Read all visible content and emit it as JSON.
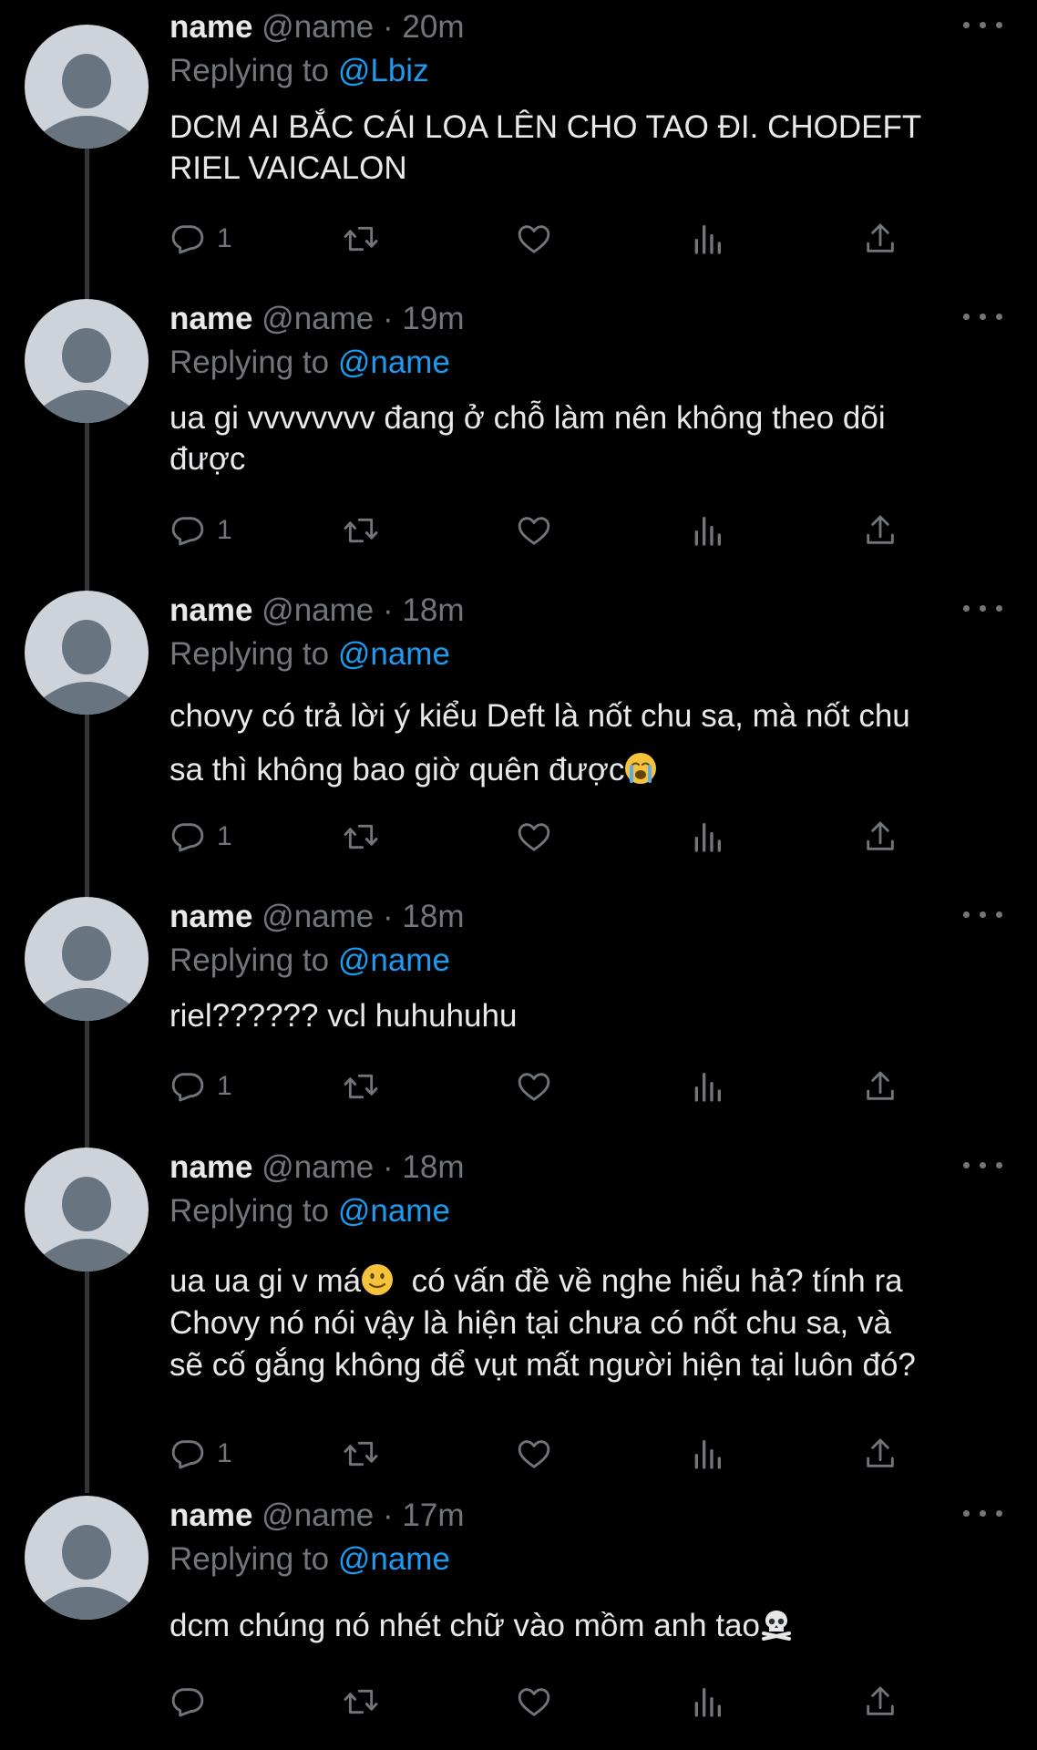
{
  "tweets": [
    {
      "display_name": "name",
      "handle": "@name",
      "separator": "·",
      "time": "20m",
      "replying_label": "Replying to",
      "replying_to": "@Lbiz",
      "text": "DCM AI BẮC CÁI LOA LÊN CHO TAO ĐI. CHODEFT\nRIEL VAICALON",
      "reply_count": "1"
    },
    {
      "display_name": "name",
      "handle": "@name",
      "separator": "·",
      "time": "19m",
      "replying_label": "Replying to",
      "replying_to": "@name",
      "text": "ua gi vvvvvvvv đang ở chỗ làm nên không theo dõi\nđược",
      "reply_count": "1"
    },
    {
      "display_name": "name",
      "handle": "@name",
      "separator": "·",
      "time": "18m",
      "replying_label": "Replying to",
      "replying_to": "@name",
      "text": "chovy có trả lời ý kiểu Deft là nốt chu sa, mà nốt chu\nsa thì không bao giờ quên được",
      "emoji": "loudly-crying-face-emoji",
      "reply_count": "1"
    },
    {
      "display_name": "name",
      "handle": "@name",
      "separator": "·",
      "time": "18m",
      "replying_label": "Replying to",
      "replying_to": "@name",
      "text": "riel?????? vcl huhuhuhu",
      "reply_count": "1"
    },
    {
      "display_name": "name",
      "handle": "@name",
      "separator": "·",
      "time": "18m",
      "replying_label": "Replying to",
      "replying_to": "@name",
      "text_before_emoji": "ua ua gi v má",
      "emoji": "slightly-smiling-face-emoji",
      "text_after_emoji": "  có vấn đề về nghe hiểu hả? tính ra\nChovy nó nói vậy là hiện tại chưa có nốt chu sa, và\nsẽ cố gắng không để vụt mất người hiện tại luôn đó?",
      "reply_count": "1"
    },
    {
      "display_name": "name",
      "handle": "@name",
      "separator": "·",
      "time": "17m",
      "replying_label": "Replying to",
      "replying_to": "@name",
      "text": "dcm chúng nó nhét chữ vào mồm anh tao",
      "emoji": "skull-and-crossbones-emoji",
      "reply_count": ""
    }
  ],
  "icons": {
    "reply": "reply-icon",
    "retweet": "retweet-icon",
    "like": "heart-icon",
    "stats": "views-stats-icon",
    "share": "share-icon",
    "more": "more-options-icon"
  },
  "colors": {
    "background": "#000000",
    "text": "#e7e9ea",
    "secondary": "#71767b",
    "link": "#1d9bf0",
    "thread_line": "#333639",
    "avatar": "#cdd3d8",
    "avatar_figure": "#68747f"
  }
}
